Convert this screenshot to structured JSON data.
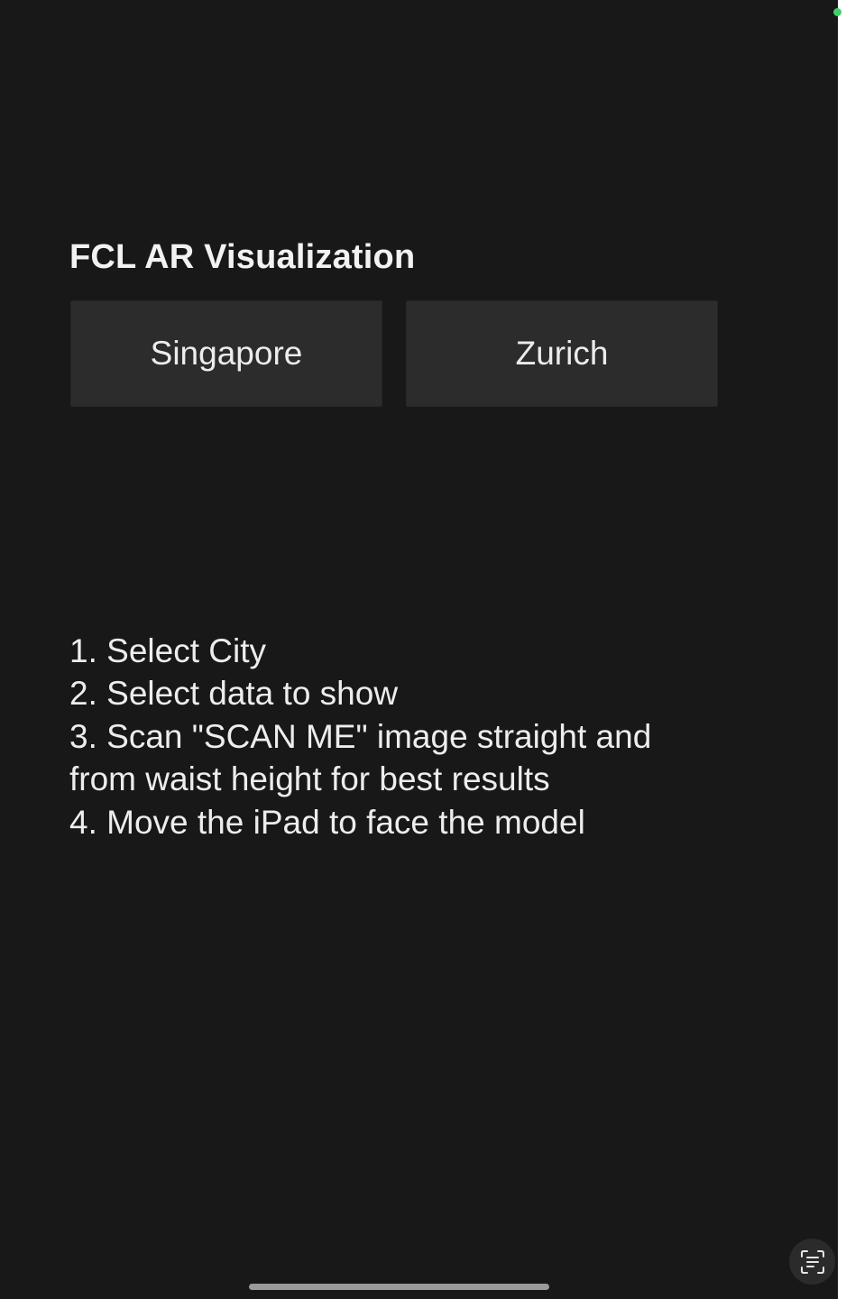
{
  "app": {
    "title": "FCL AR Visualization"
  },
  "cities": [
    {
      "label": "Singapore"
    },
    {
      "label": "Zurich"
    }
  ],
  "instructions": [
    "1. Select City",
    "2. Select data to show",
    "3. Scan \"SCAN ME\" image straight and",
    "from waist height for best results",
    "4. Move the iPad to face the model"
  ],
  "icons": {
    "live_text": "text-scan-icon",
    "status_dot": "camera-indicator-dot"
  },
  "colors": {
    "background": "#181818",
    "button": "#2c2c2c",
    "text": "#ececec",
    "indicator_dot": "#3fd06a"
  }
}
